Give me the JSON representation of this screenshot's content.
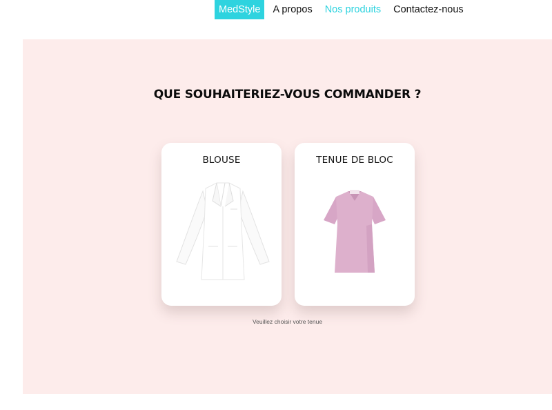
{
  "nav": {
    "brand": "MedStyle",
    "items": [
      {
        "label": "A propos"
      },
      {
        "label": "Nos produits"
      },
      {
        "label": "Contactez-nous"
      }
    ],
    "brand_color": "#2ed3df",
    "active_color": "#2ed3df"
  },
  "main": {
    "background": "#fdeceb",
    "question": "QUE SOUHAITERIEZ-VOUS COMMANDER ?",
    "cards": [
      {
        "title": "BLOUSE",
        "image": "white-lab-coat-icon"
      },
      {
        "title": "TENUE DE BLOC",
        "image": "pink-scrub-top-icon"
      }
    ],
    "hint": "Veuillez choisir votre tenue"
  }
}
